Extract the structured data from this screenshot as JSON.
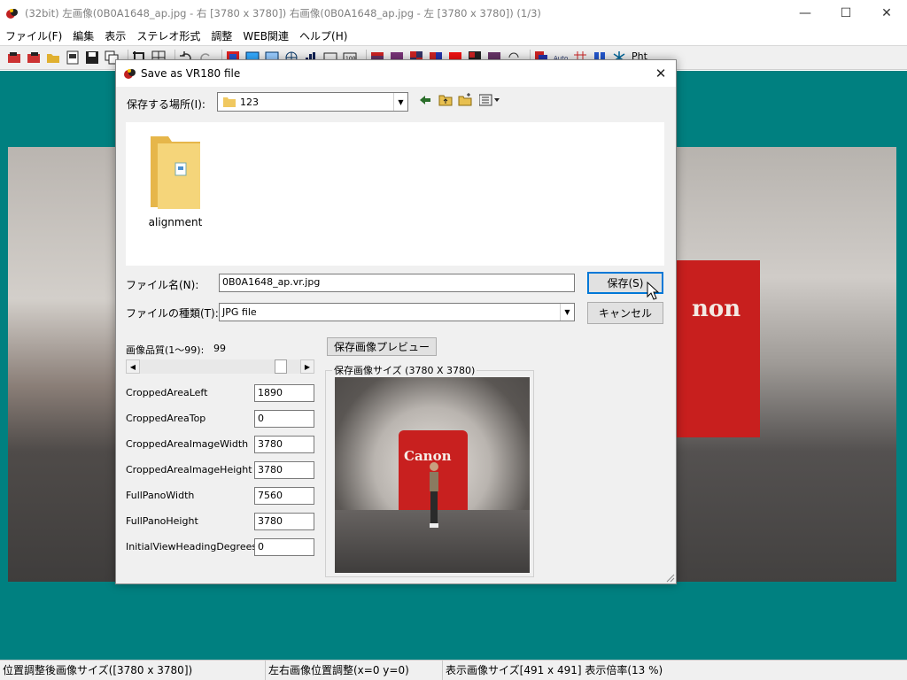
{
  "window": {
    "title": "(32bit) 左画像(0B0A1648_ap.jpg - 右 [3780 x 3780]) 右画像(0B0A1648_ap.jpg - 左 [3780 x 3780]) (1/3)",
    "minimize": "—",
    "maximize": "☐",
    "close": "✕"
  },
  "menu": [
    "ファイル(F)",
    "編集",
    "表示",
    "ステレオ形式",
    "調整",
    "WEB関連",
    "ヘルプ(H)"
  ],
  "toolbar": {
    "pht_label": "Pht"
  },
  "background_image": {
    "logo_text": "non"
  },
  "dialog": {
    "title": "Save as VR180 file",
    "close": "✕",
    "save_in_label": "保存する場所(I):",
    "save_in_value": "123",
    "folder_items": [
      {
        "name": "alignment",
        "icon": "folder-icon"
      }
    ],
    "filename_label": "ファイル名(N):",
    "filename_value": "0B0A1648_ap.vr.jpg",
    "filetype_label": "ファイルの種類(T):",
    "filetype_value": "JPG file",
    "save_button": "保存(S)",
    "cancel_button": "キャンセル",
    "quality_label": "画像品質(1～99):",
    "quality_value": "99",
    "quality_slider": 0.91,
    "preview_button": "保存画像プレビュー",
    "preview_group_label": "保存画像サイズ (3780 X 3780)",
    "preview_logo_text": "Canon",
    "fields": [
      {
        "label": "CroppedAreaLeft",
        "value": "1890"
      },
      {
        "label": "CroppedAreaTop",
        "value": "0"
      },
      {
        "label": "CroppedAreaImageWidth",
        "value": "3780"
      },
      {
        "label": "CroppedAreaImageHeight",
        "value": "3780"
      },
      {
        "label": "FullPanoWidth",
        "value": "7560"
      },
      {
        "label": "FullPanoHeight",
        "value": "3780"
      },
      {
        "label": "InitialViewHeadingDegrees",
        "value": "0"
      }
    ]
  },
  "status": [
    "位置調整後画像サイズ([3780 x 3780])",
    "左右画像位置調整(x=0 y=0)",
    "表示画像サイズ[491 x 491]  表示倍率(13 %)"
  ],
  "colors": {
    "workspace_bg": "#008080",
    "canon_red": "#c8201f",
    "focus_blue": "#0078d7"
  }
}
